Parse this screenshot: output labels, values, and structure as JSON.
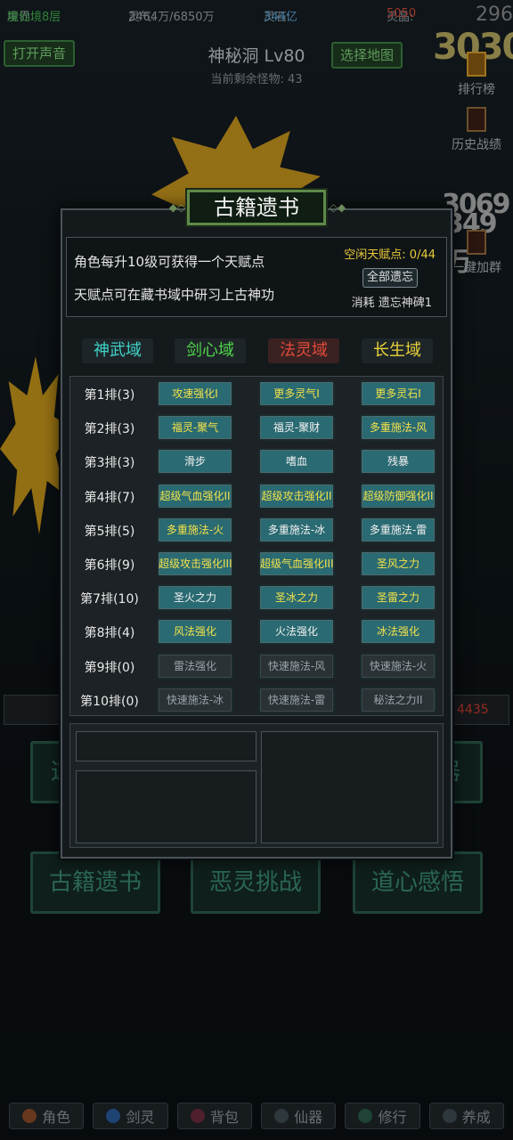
{
  "topbar": {
    "realm_label": "境界:",
    "realm_value": "魔仙境8层",
    "qi_label": "灵气:",
    "qi_value": "2464万/6850万",
    "stone_label": "灵石:",
    "stone_value": "344亿",
    "crystal_label": "灵晶:",
    "crystal_value": "5050",
    "corner_num": "296"
  },
  "header": {
    "sound_button": "打开声音",
    "map_button": "选择地图",
    "title": "神秘洞 Lv80",
    "remaining": "当前剩余怪物: 43"
  },
  "right_sidebar": {
    "items": [
      "排行榜",
      "历史战绩",
      "一键加群"
    ]
  },
  "background_numbers": [
    "3030",
    "3069",
    "349万"
  ],
  "background_buttons": [
    "古籍遗书",
    "恶灵挑战",
    "道心感悟"
  ],
  "background_partial": [
    "这",
    "器"
  ],
  "side_value": "4435",
  "bottom_nav": [
    "角色",
    "剑灵",
    "背包",
    "仙器",
    "修行",
    "养成"
  ],
  "modal": {
    "title": "古籍遗书",
    "info_line1": "角色每升10级可获得一个天赋点",
    "info_line2": "天赋点可在藏书域中研习上古神功",
    "free_points": "空闲天赋点: 0/44",
    "forget_all_button": "全部遗忘",
    "cost": "消耗 遗忘神碑1",
    "tabs": [
      {
        "label": "神武域",
        "color": "#3ed3c8"
      },
      {
        "label": "剑心域",
        "color": "#4fd64a"
      },
      {
        "label": "法灵域",
        "color": "#e24a3a"
      },
      {
        "label": "长生域",
        "color": "#e8d23a"
      }
    ],
    "rows": [
      {
        "label": "第1排(3)",
        "skills": [
          [
            "攻速强化I",
            "y"
          ],
          [
            "更多灵气I",
            "y"
          ],
          [
            "更多灵石I",
            "y"
          ]
        ]
      },
      {
        "label": "第2排(3)",
        "skills": [
          [
            "福灵-聚气",
            "y"
          ],
          [
            "福灵-聚财",
            "w"
          ],
          [
            "多重施法-风",
            "y"
          ]
        ]
      },
      {
        "label": "第3排(3)",
        "skills": [
          [
            "滑步",
            "w"
          ],
          [
            "嗜血",
            "w"
          ],
          [
            "残暴",
            "w"
          ]
        ]
      },
      {
        "label": "第4排(7)",
        "skills": [
          [
            "超级气血强化II",
            "y"
          ],
          [
            "超级攻击强化II",
            "y"
          ],
          [
            "超级防御强化II",
            "y"
          ]
        ]
      },
      {
        "label": "第5排(5)",
        "skills": [
          [
            "多重施法-火",
            "y"
          ],
          [
            "多重施法-冰",
            "w"
          ],
          [
            "多重施法-雷",
            "w"
          ]
        ]
      },
      {
        "label": "第6排(9)",
        "skills": [
          [
            "超级攻击强化III",
            "y"
          ],
          [
            "超级气血强化III",
            "y"
          ],
          [
            "圣风之力",
            "y"
          ]
        ]
      },
      {
        "label": "第7排(10)",
        "skills": [
          [
            "圣火之力",
            "w"
          ],
          [
            "圣冰之力",
            "y"
          ],
          [
            "圣雷之力",
            "y"
          ]
        ]
      },
      {
        "label": "第8排(4)",
        "skills": [
          [
            "风法强化",
            "y"
          ],
          [
            "火法强化",
            "w"
          ],
          [
            "冰法强化",
            "y"
          ]
        ]
      },
      {
        "label": "第9排(0)",
        "skills": [
          [
            "雷法强化",
            "d"
          ],
          [
            "快速施法-风",
            "d"
          ],
          [
            "快速施法-火",
            "d"
          ]
        ]
      },
      {
        "label": "第10排(0)",
        "skills": [
          [
            "快速施法-冰",
            "d"
          ],
          [
            "快速施法-雷",
            "d"
          ],
          [
            "秘法之力II",
            "d"
          ]
        ]
      }
    ]
  }
}
